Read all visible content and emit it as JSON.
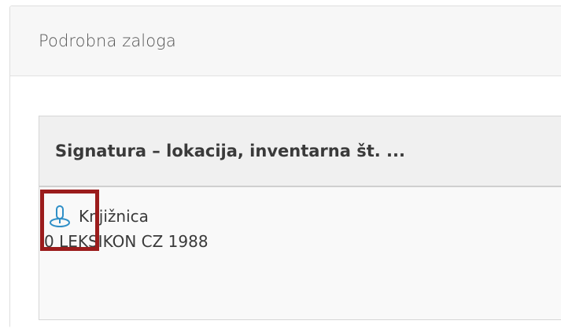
{
  "panel": {
    "title": "Podrobna zaloga"
  },
  "table": {
    "column_header": "Signatura – lokacija, inventarna št. ...",
    "rows": [
      {
        "location": "Knjižnica",
        "signature": "0 LEKSIKON CZ 1988",
        "icon": "location-pin-icon"
      }
    ]
  },
  "colors": {
    "icon": "#2f8fc7",
    "highlight": "#9b1c1c",
    "header_bg": "#f0f0f0"
  }
}
